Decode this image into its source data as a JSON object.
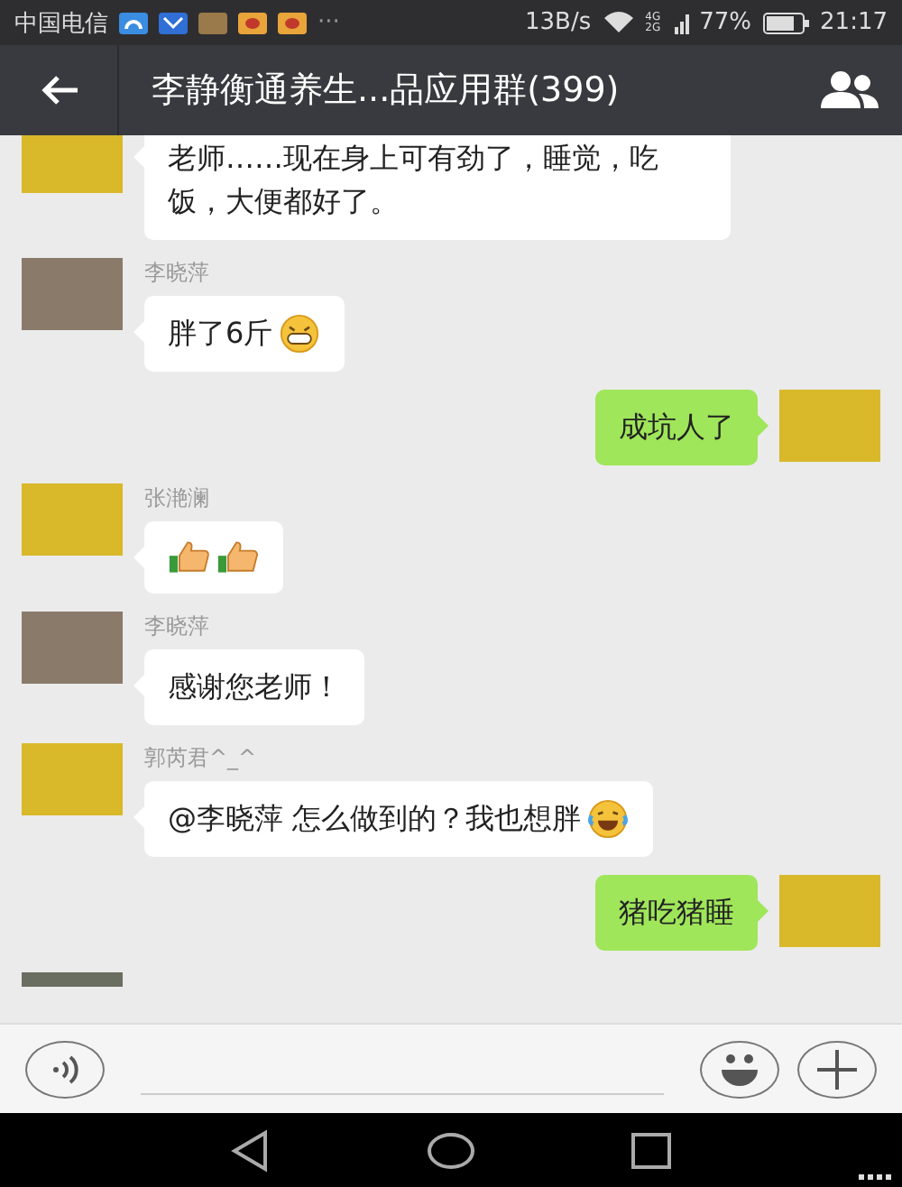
{
  "status_bar": {
    "carrier": "中国电信",
    "more": "···",
    "speed": "13B/s",
    "network": "4G 2G",
    "battery": "77%",
    "time": "21:17"
  },
  "header": {
    "title": "李静衡通养生...品应用群(399)"
  },
  "messages": [
    {
      "kind": "in",
      "parts": [
        {
          "kind": "text",
          "text": "老师……现在身上可有劲了，睡觉，吃饭，大便都好了。"
        }
      ]
    },
    {
      "kind": "in",
      "sender": "李晓萍",
      "parts": [
        {
          "kind": "text",
          "text": "胖了6斤"
        },
        {
          "kind": "grin"
        }
      ]
    },
    {
      "kind": "out",
      "parts": [
        {
          "kind": "text",
          "text": "成坑人了"
        }
      ]
    },
    {
      "kind": "in",
      "sender": "张滟澜",
      "parts": [
        {
          "kind": "thumbs"
        },
        {
          "kind": "thumbs"
        }
      ]
    },
    {
      "kind": "in",
      "sender": "李晓萍",
      "parts": [
        {
          "kind": "text",
          "text": "感谢您老师！"
        }
      ]
    },
    {
      "kind": "in",
      "sender": "郭芮君^_^",
      "parts": [
        {
          "kind": "text",
          "text": "@李晓萍 怎么做到的？我也想胖"
        },
        {
          "kind": "tears"
        }
      ]
    },
    {
      "kind": "out",
      "parts": [
        {
          "kind": "text",
          "text": "猪吃猪睡"
        }
      ]
    },
    {
      "kind": "cut"
    }
  ]
}
